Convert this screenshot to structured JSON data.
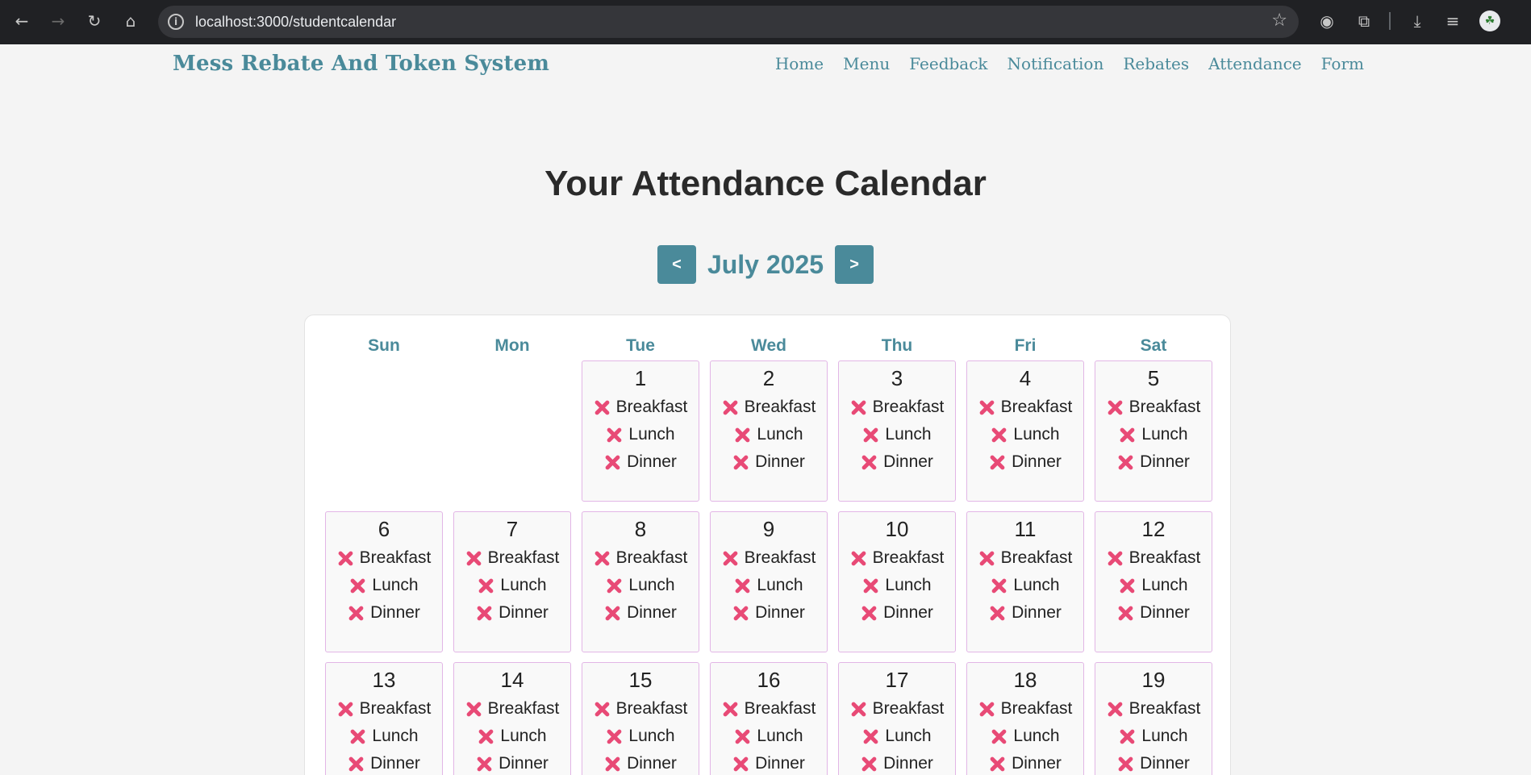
{
  "browser": {
    "url": "localhost:3000/studentcalendar"
  },
  "site": {
    "brand": "Mess Rebate And Token System",
    "nav": [
      "Home",
      "Menu",
      "Feedback",
      "Notification",
      "Rebates",
      "Attendance",
      "Form"
    ]
  },
  "page": {
    "title": "Your Attendance Calendar",
    "month_label": "July 2025",
    "prev_label": "<",
    "next_label": ">"
  },
  "calendar": {
    "weekdays": [
      "Sun",
      "Mon",
      "Tue",
      "Wed",
      "Thu",
      "Fri",
      "Sat"
    ],
    "leading_blank_days": 2,
    "meals": [
      "Breakfast",
      "Lunch",
      "Dinner"
    ],
    "attendance_status": "absent",
    "status_icon": "cross-icon",
    "status_color": "#e84a76",
    "days": [
      1,
      2,
      3,
      4,
      5,
      6,
      7,
      8,
      9,
      10,
      11,
      12,
      13,
      14,
      15,
      16,
      17,
      18,
      19
    ]
  },
  "colors": {
    "accent": "#4a8a9a",
    "day_border": "#e2b6e6",
    "page_bg": "#f4f4f4"
  }
}
